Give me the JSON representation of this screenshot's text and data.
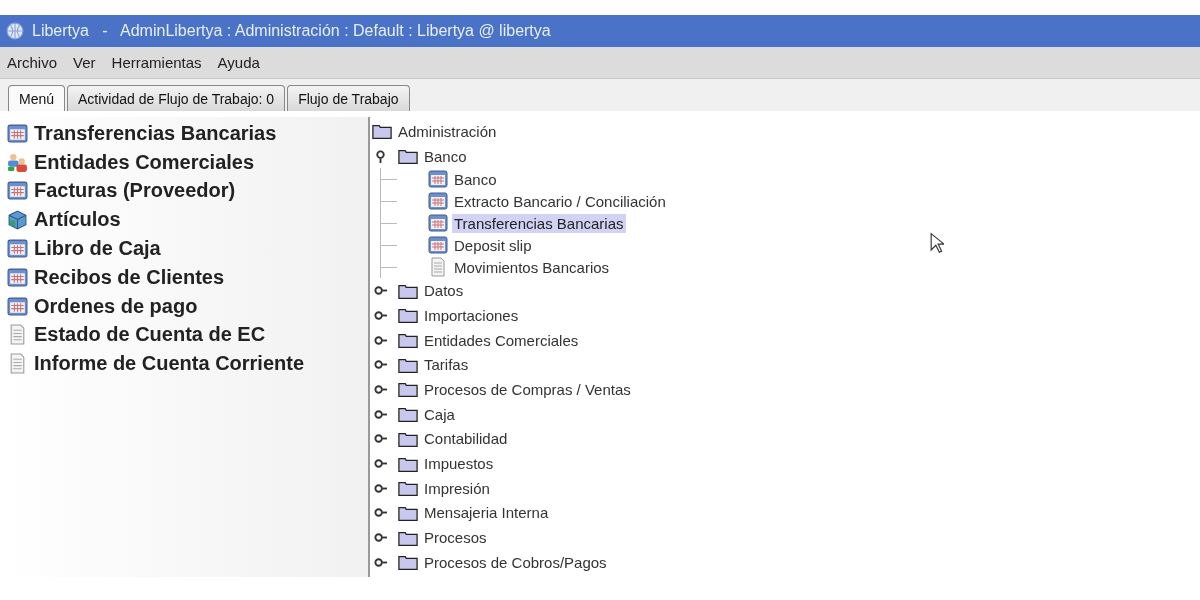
{
  "window": {
    "title": "Libertya   -   AdminLibertya : Administración : Default : Libertya @ libertya"
  },
  "menu_bar": [
    "Archivo",
    "Ver",
    "Herramientas",
    "Ayuda"
  ],
  "tabs": [
    {
      "label": "Menú",
      "selected": true
    },
    {
      "label": "Actividad de Flujo de Trabajo: 0",
      "selected": false
    },
    {
      "label": "Flujo de Trabajo",
      "selected": false
    }
  ],
  "favorites": [
    {
      "label": "Transferencias Bancarias",
      "kind": "window"
    },
    {
      "label": "Entidades Comerciales",
      "kind": "people"
    },
    {
      "label": "Facturas (Proveedor)",
      "kind": "window"
    },
    {
      "label": "Artículos",
      "kind": "product"
    },
    {
      "label": "Libro de Caja",
      "kind": "window"
    },
    {
      "label": "Recibos de Clientes",
      "kind": "window"
    },
    {
      "label": "Ordenes de pago",
      "kind": "window"
    },
    {
      "label": "Estado de Cuenta de EC",
      "kind": "report"
    },
    {
      "label": "Informe de Cuenta Corriente",
      "kind": "report"
    }
  ],
  "tree": {
    "label": "Administración",
    "kind": "folder",
    "expanded": true,
    "selected": false,
    "children": [
      {
        "label": "Banco",
        "kind": "folder",
        "expanded": true,
        "selected": false,
        "children": [
          {
            "label": "Banco",
            "kind": "window",
            "selected": false
          },
          {
            "label": "Extracto Bancario / Conciliación",
            "kind": "window",
            "selected": false
          },
          {
            "label": "Transferencias Bancarias",
            "kind": "window",
            "selected": true
          },
          {
            "label": "Deposit slip",
            "kind": "window",
            "selected": false
          },
          {
            "label": "Movimientos Bancarios",
            "kind": "report",
            "selected": false
          }
        ]
      },
      {
        "label": "Datos",
        "kind": "folder",
        "expanded": false,
        "selected": false
      },
      {
        "label": "Importaciones",
        "kind": "folder",
        "expanded": false,
        "selected": false
      },
      {
        "label": "Entidades Comerciales",
        "kind": "folder",
        "expanded": false,
        "selected": false
      },
      {
        "label": "Tarifas",
        "kind": "folder",
        "expanded": false,
        "selected": false
      },
      {
        "label": "Procesos de Compras / Ventas",
        "kind": "folder",
        "expanded": false,
        "selected": false
      },
      {
        "label": "Caja",
        "kind": "folder",
        "expanded": false,
        "selected": false
      },
      {
        "label": "Contabilidad",
        "kind": "folder",
        "expanded": false,
        "selected": false
      },
      {
        "label": "Impuestos",
        "kind": "folder",
        "expanded": false,
        "selected": false
      },
      {
        "label": "Impresión",
        "kind": "folder",
        "expanded": false,
        "selected": false
      },
      {
        "label": "Mensajeria Interna",
        "kind": "folder",
        "expanded": false,
        "selected": false
      },
      {
        "label": "Procesos",
        "kind": "folder",
        "expanded": false,
        "selected": false
      },
      {
        "label": "Procesos de Cobros/Pagos",
        "kind": "folder",
        "expanded": false,
        "selected": false
      }
    ]
  }
}
